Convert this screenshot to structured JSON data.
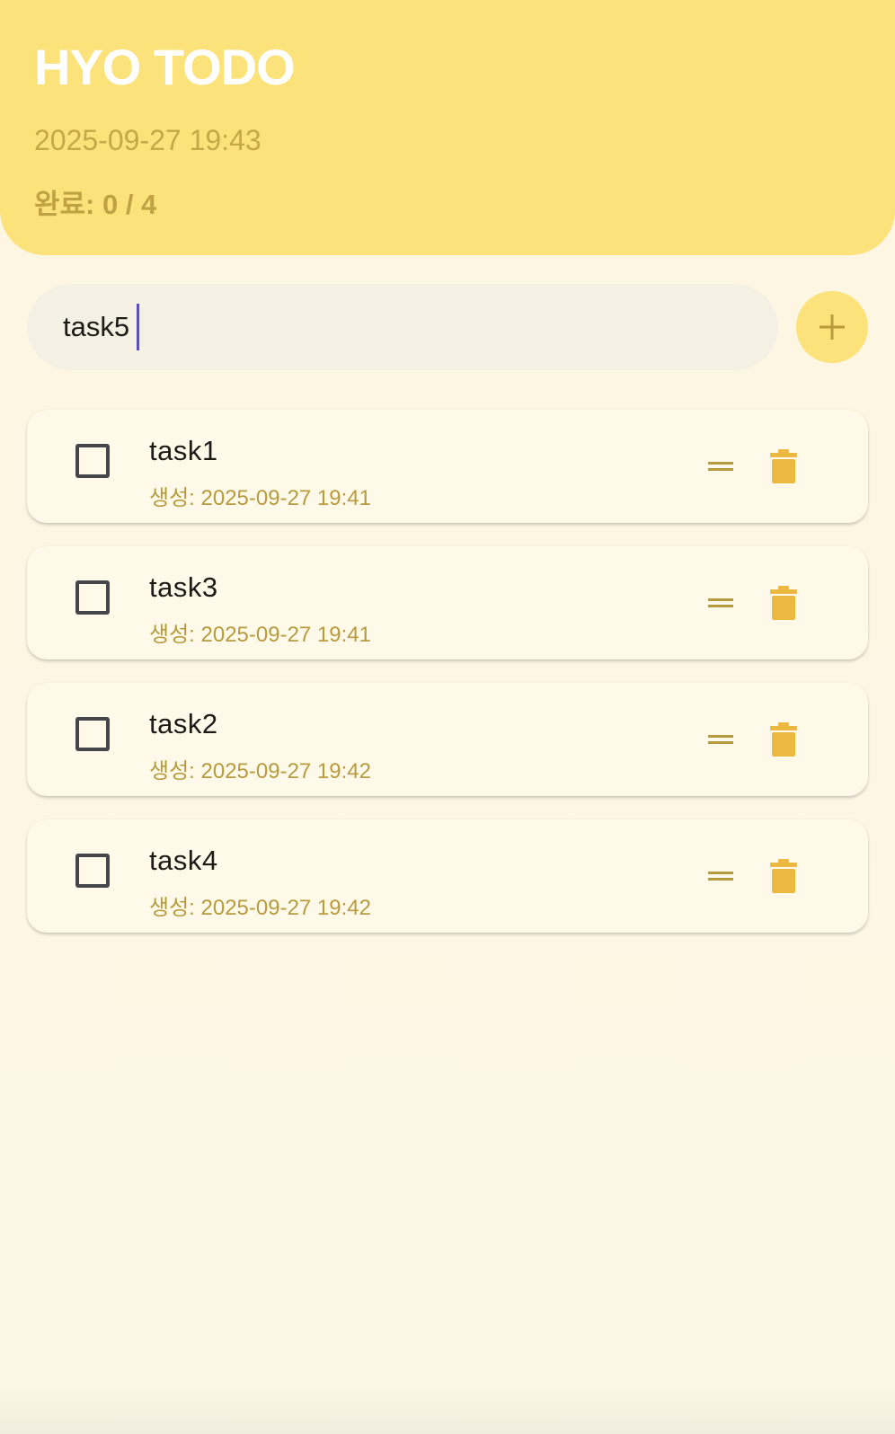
{
  "header": {
    "title": "HYO TODO",
    "datetime": "2025-09-27 19:43",
    "progress": "완료: 0 / 4"
  },
  "input": {
    "value": "task5",
    "add_icon": "plus-icon"
  },
  "todos": [
    {
      "title": "task1",
      "created": "생성: 2025-09-27 19:41",
      "done": false
    },
    {
      "title": "task3",
      "created": "생성: 2025-09-27 19:41",
      "done": false
    },
    {
      "title": "task2",
      "created": "생성: 2025-09-27 19:42",
      "done": false
    },
    {
      "title": "task4",
      "created": "생성: 2025-09-27 19:42",
      "done": false
    }
  ],
  "icons": {
    "drag": "drag-handle-icon",
    "delete": "trash-icon",
    "checkbox": "checkbox-unchecked-icon"
  },
  "colors": {
    "header_bg": "#fbe27b",
    "accent_text": "#c5a848",
    "trash": "#ebb93f",
    "drag": "#b89b3e",
    "background": "#fdf6e1"
  }
}
